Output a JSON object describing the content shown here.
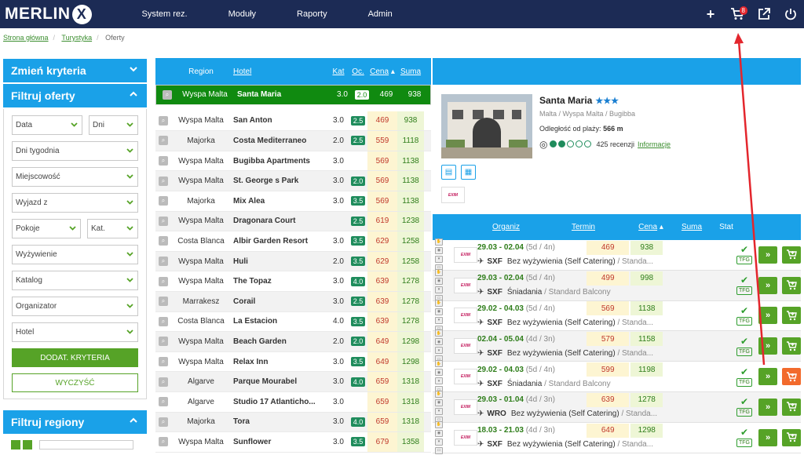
{
  "app": {
    "logo_text": "MERLIN",
    "logo_x": "X",
    "cart_count": "8"
  },
  "nav": [
    "System rez.",
    "Moduły",
    "Raporty",
    "Admin"
  ],
  "breadcrumb": [
    "Strona główna",
    "Turystyka",
    "Oferty"
  ],
  "sidebar": {
    "change_criteria": "Zmień kryteria",
    "filter_offers": "Filtruj oferty",
    "fields": {
      "data": "Data",
      "dni": "Dni",
      "dni_tygodnia": "Dni tygodnia",
      "miejscowosc": "Miejscowość",
      "wyjazd": "Wyjazd z",
      "pokoje": "Pokoje",
      "kat": "Kat.",
      "wyzywienie": "Wyżywienie",
      "katalog": "Katalog",
      "organizator": "Organizator",
      "hotel": "Hotel"
    },
    "add_criteria": "DODAT. KRYTERIA",
    "clear": "WYCZYŚĆ",
    "filter_regions": "Filtruj regiony"
  },
  "hotels_table": {
    "headers": {
      "region": "Region",
      "hotel": "Hotel",
      "kat": "Kat",
      "oc": "Oc.",
      "cena": "Cena",
      "suma": "Suma"
    },
    "rows": [
      {
        "region": "Wyspa Malta",
        "hotel": "Santa Maria",
        "kat": "3.0",
        "oc": "2.0",
        "cena": "469",
        "suma": "938"
      },
      {
        "region": "Wyspa Malta",
        "hotel": "San Anton",
        "kat": "3.0",
        "oc": "2.5",
        "cena": "469",
        "suma": "938"
      },
      {
        "region": "Majorka",
        "hotel": "Costa Mediterraneo",
        "kat": "2.0",
        "oc": "2.5",
        "cena": "559",
        "suma": "1118"
      },
      {
        "region": "Wyspa Malta",
        "hotel": "Bugibba Apartments",
        "kat": "3.0",
        "oc": "",
        "cena": "569",
        "suma": "1138"
      },
      {
        "region": "Wyspa Malta",
        "hotel": "St. George s Park",
        "kat": "3.0",
        "oc": "2.0",
        "cena": "569",
        "suma": "1138"
      },
      {
        "region": "Majorka",
        "hotel": "Mix Alea",
        "kat": "3.0",
        "oc": "3.5",
        "cena": "569",
        "suma": "1138"
      },
      {
        "region": "Wyspa Malta",
        "hotel": "Dragonara Court",
        "kat": "",
        "oc": "2.5",
        "cena": "619",
        "suma": "1238"
      },
      {
        "region": "Costa Blanca",
        "hotel": "Albir Garden Resort",
        "kat": "3.0",
        "oc": "3.5",
        "cena": "629",
        "suma": "1258"
      },
      {
        "region": "Wyspa Malta",
        "hotel": "Huli",
        "kat": "2.0",
        "oc": "3.5",
        "cena": "629",
        "suma": "1258"
      },
      {
        "region": "Wyspa Malta",
        "hotel": "The Topaz",
        "kat": "3.0",
        "oc": "4.0",
        "cena": "639",
        "suma": "1278"
      },
      {
        "region": "Marrakesz",
        "hotel": "Corail",
        "kat": "3.0",
        "oc": "2.5",
        "cena": "639",
        "suma": "1278"
      },
      {
        "region": "Costa Blanca",
        "hotel": "La Estacion",
        "kat": "4.0",
        "oc": "3.5",
        "cena": "639",
        "suma": "1278"
      },
      {
        "region": "Wyspa Malta",
        "hotel": "Beach Garden",
        "kat": "2.0",
        "oc": "2.0",
        "cena": "649",
        "suma": "1298"
      },
      {
        "region": "Wyspa Malta",
        "hotel": "Relax Inn",
        "kat": "3.0",
        "oc": "3.5",
        "cena": "649",
        "suma": "1298"
      },
      {
        "region": "Algarve",
        "hotel": "Parque Mourabel",
        "kat": "3.0",
        "oc": "4.0",
        "cena": "659",
        "suma": "1318"
      },
      {
        "region": "Algarve",
        "hotel": "Studio 17 Atlanticho...",
        "kat": "3.0",
        "oc": "",
        "cena": "659",
        "suma": "1318"
      },
      {
        "region": "Majorka",
        "hotel": "Tora",
        "kat": "3.0",
        "oc": "4.0",
        "cena": "659",
        "suma": "1318"
      },
      {
        "region": "Wyspa Malta",
        "hotel": "Sunflower",
        "kat": "3.0",
        "oc": "3.5",
        "cena": "679",
        "suma": "1358"
      }
    ]
  },
  "detail": {
    "name": "Santa Maria",
    "stars": "★★★",
    "location": "Malta / Wyspa Malta / Bugibba",
    "distance_label": "Odległość od plaży:",
    "distance_value": "566 m",
    "reviews": "425 recenzji",
    "info_link": "Informacje",
    "rating_filled": 2,
    "rating_total": 5
  },
  "offers_table": {
    "headers": {
      "organiz": "Organiz",
      "termin": "Termin",
      "cena": "Cena",
      "suma": "Suma",
      "stat": "Stat"
    },
    "rows": [
      {
        "date": "29.03 - 02.04",
        "nights": "(5d / 4n)",
        "cena": "469",
        "suma": "938",
        "airport": "SXF",
        "board": "Bez wyżywienia (Self Catering)",
        "room": "/ Standa...",
        "tfg": "TFG"
      },
      {
        "date": "29.03 - 02.04",
        "nights": "(5d / 4n)",
        "cena": "499",
        "suma": "998",
        "airport": "SXF",
        "board": "Śniadania",
        "room": "/ Standard Balcony",
        "tfg": "TFG"
      },
      {
        "date": "29.02 - 04.03",
        "nights": "(5d / 4n)",
        "cena": "569",
        "suma": "1138",
        "airport": "SXF",
        "board": "Bez wyżywienia (Self Catering)",
        "room": "/ Standa...",
        "tfg": "TFG"
      },
      {
        "date": "02.04 - 05.04",
        "nights": "(4d / 3n)",
        "cena": "579",
        "suma": "1158",
        "airport": "SXF",
        "board": "Bez wyżywienia (Self Catering)",
        "room": "/ Standa...",
        "tfg": "TFG"
      },
      {
        "date": "29.02 - 04.03",
        "nights": "(5d / 4n)",
        "cena": "599",
        "suma": "1198",
        "airport": "SXF",
        "board": "Śniadania",
        "room": "/ Standard Balcony",
        "tfg": "TFG"
      },
      {
        "date": "29.03 - 01.04",
        "nights": "(4d / 3n)",
        "cena": "639",
        "suma": "1278",
        "airport": "WRO",
        "board": "Bez wyżywienia (Self Catering)",
        "room": "/ Standa...",
        "tfg": "TFG"
      },
      {
        "date": "18.03 - 21.03",
        "nights": "(4d / 3n)",
        "cena": "649",
        "suma": "1298",
        "airport": "SXF",
        "board": "Bez wyżywienia (Self Catering)",
        "room": "/ Standa...",
        "tfg": "TFG"
      }
    ],
    "btn_more": "»",
    "btn_r": "R"
  },
  "colors": {
    "topbar": "#1c2b55",
    "accent": "#1aa1e8",
    "green": "#56a327",
    "orange": "#f26a2c",
    "arrow": "#e3262d"
  }
}
